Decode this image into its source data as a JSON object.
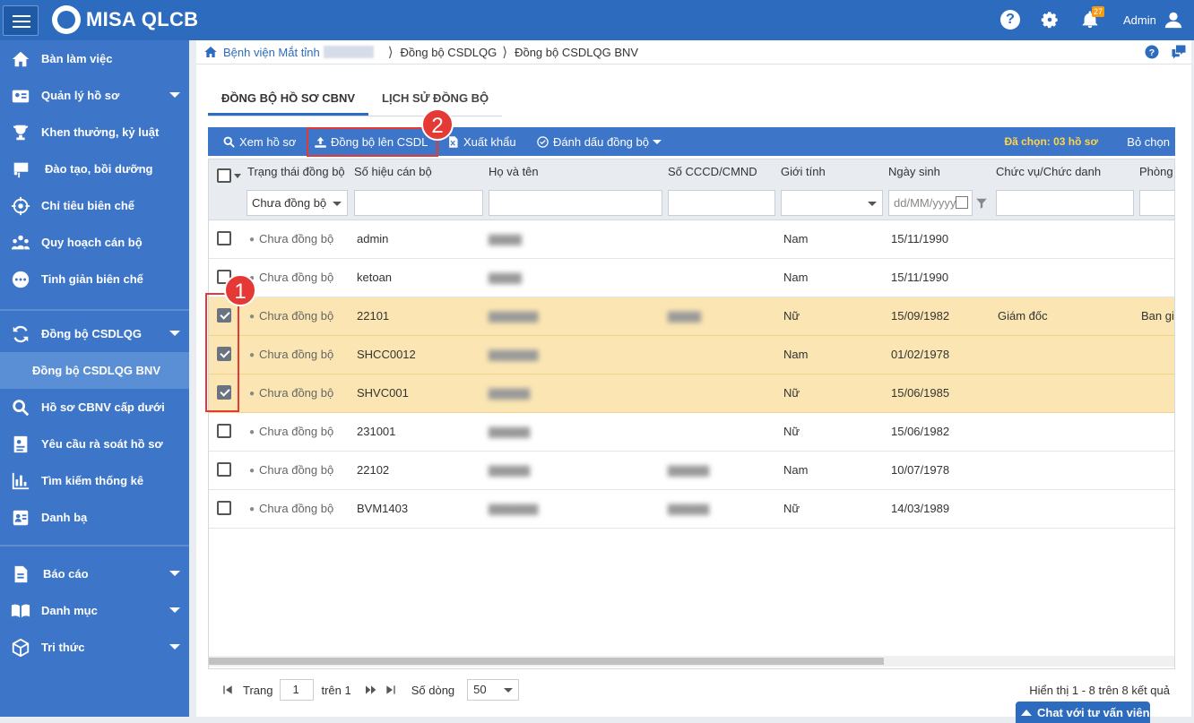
{
  "app": {
    "title": "MISA QLCB",
    "notification_count": "27",
    "user": "Admin"
  },
  "sidebar": {
    "items": [
      {
        "label": "Bàn làm việc",
        "icon": "home-icon"
      },
      {
        "label": "Quản lý hồ sơ",
        "icon": "profile-card-icon"
      },
      {
        "label": "Khen thưởng, kỷ luật",
        "icon": "trophy-icon"
      },
      {
        "label": "Đào tạo, bồi dưỡng",
        "icon": "training-board-icon"
      },
      {
        "label": "Chỉ tiêu biên chế",
        "icon": "target-icon"
      },
      {
        "label": "Quy hoạch cán bộ",
        "icon": "team-icon"
      },
      {
        "label": "Tinh giản biên chế",
        "icon": "more-dots-icon"
      },
      {
        "label": "Đồng bộ CSDLQG",
        "icon": "sync-icon"
      },
      {
        "label": "Đồng bộ CSDLQG BNV",
        "icon": ""
      },
      {
        "label": "Hồ sơ CBNV cấp dưới",
        "icon": "search-icon"
      },
      {
        "label": "Yêu cầu rà soát hồ sơ",
        "icon": "review-request-icon"
      },
      {
        "label": "Tìm kiếm thống kê",
        "icon": "bar-chart-icon"
      },
      {
        "label": "Danh bạ",
        "icon": "contacts-icon"
      },
      {
        "label": "Báo cáo",
        "icon": "report-icon"
      },
      {
        "label": "Danh mục",
        "icon": "book-icon"
      },
      {
        "label": "Tri thức",
        "icon": "cube-icon"
      }
    ]
  },
  "breadcrumb": {
    "level1": "Bệnh viện Mắt tỉnh",
    "level2": "Đồng bộ CSDLQG",
    "level3": "Đồng bộ CSDLQG BNV"
  },
  "tabs": {
    "sync_profiles": "ĐỒNG BỘ HỒ SƠ CBNV",
    "sync_history": "LỊCH SỬ ĐỒNG BỘ"
  },
  "toolbar": {
    "view_profile": "Xem hồ sơ",
    "sync_upload": "Đồng bộ lên CSDL",
    "export": "Xuất khẩu",
    "mark_synced": "Đánh dấu đồng bộ",
    "selected_count": "Đã chọn: 03 hồ sơ",
    "deselect": "Bỏ chọn"
  },
  "grid": {
    "columns": {
      "status": "Trạng thái đồng bộ",
      "employee_code": "Số hiệu cán bộ",
      "full_name": "Họ và tên",
      "id_number": "Số CCCD/CMND",
      "gender": "Giới tính",
      "birth_date": "Ngày sinh",
      "position": "Chức vụ/Chức danh",
      "department": "Phòng"
    },
    "filters": {
      "status_value": "Chưa đồng bộ",
      "birth_date_placeholder": "dd/MM/yyyy"
    },
    "rows": [
      {
        "checked": false,
        "status": "Chưa đồng bộ",
        "code": "admin",
        "gender": "Nam",
        "birth": "15/11/1990",
        "position": "",
        "department": ""
      },
      {
        "checked": false,
        "status": "Chưa đồng bộ",
        "code": "ketoan",
        "gender": "Nam",
        "birth": "15/11/1990",
        "position": "",
        "department": ""
      },
      {
        "checked": true,
        "status": "Chưa đồng bộ",
        "code": "22101",
        "gender": "Nữ",
        "birth": "15/09/1982",
        "position": "Giám đốc",
        "department": "Ban gi"
      },
      {
        "checked": true,
        "status": "Chưa đồng bộ",
        "code": "SHCC0012",
        "gender": "Nam",
        "birth": "01/02/1978",
        "position": "",
        "department": ""
      },
      {
        "checked": true,
        "status": "Chưa đồng bộ",
        "code": "SHVC001",
        "gender": "Nữ",
        "birth": "15/06/1985",
        "position": "",
        "department": ""
      },
      {
        "checked": false,
        "status": "Chưa đồng bộ",
        "code": "231001",
        "gender": "Nữ",
        "birth": "15/06/1982",
        "position": "",
        "department": ""
      },
      {
        "checked": false,
        "status": "Chưa đồng bộ",
        "code": "22102",
        "gender": "Nam",
        "birth": "10/07/1978",
        "position": "",
        "department": ""
      },
      {
        "checked": false,
        "status": "Chưa đồng bộ",
        "code": "BVM1403",
        "gender": "Nữ",
        "birth": "14/03/1989",
        "position": "",
        "department": ""
      }
    ]
  },
  "pager": {
    "page_label": "Trang",
    "page": "1",
    "of_label": "trên 1",
    "rows_label": "Số dòng",
    "rows_per_page": "50",
    "summary": "Hiển thị 1 - 8 trên 8 kết quả"
  },
  "chat": {
    "label": "Chat với tư vấn viên"
  },
  "callouts": {
    "first": "1",
    "second": "2"
  },
  "colors": {
    "brand": "#2d6bbf",
    "sidebar": "#3d75c9",
    "selected_row": "#fbe6b3",
    "selected_text": "#ffd54a",
    "callout": "#e53935"
  }
}
